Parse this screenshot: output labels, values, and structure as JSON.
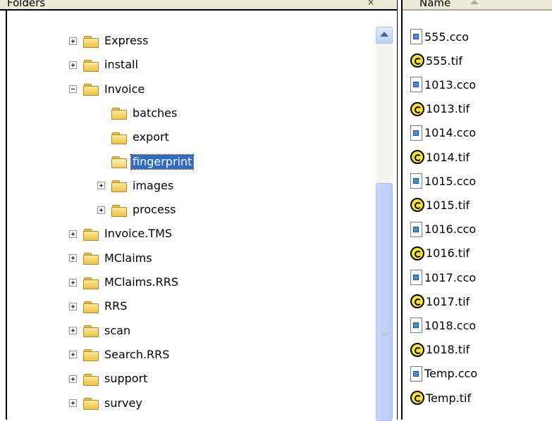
{
  "folders_pane": {
    "title": "Folders",
    "close_glyph": "×",
    "tree": [
      {
        "label": "Express",
        "expander": "plus",
        "level": 0,
        "selected": false
      },
      {
        "label": "install",
        "expander": "plus",
        "level": 0,
        "selected": false
      },
      {
        "label": "Invoice",
        "expander": "minus",
        "level": 0,
        "selected": false
      },
      {
        "label": "batches",
        "expander": "none",
        "level": 1,
        "selected": false
      },
      {
        "label": "export",
        "expander": "none",
        "level": 1,
        "selected": false
      },
      {
        "label": "fingerprint",
        "expander": "none",
        "level": 1,
        "selected": true
      },
      {
        "label": "images",
        "expander": "plus",
        "level": 1,
        "selected": false
      },
      {
        "label": "process",
        "expander": "plus",
        "level": 1,
        "selected": false
      },
      {
        "label": "Invoice.TMS",
        "expander": "plus",
        "level": 0,
        "selected": false
      },
      {
        "label": "MClaims",
        "expander": "plus",
        "level": 0,
        "selected": false
      },
      {
        "label": "MClaims.RRS",
        "expander": "plus",
        "level": 0,
        "selected": false
      },
      {
        "label": "RRS",
        "expander": "plus",
        "level": 0,
        "selected": false
      },
      {
        "label": "scan",
        "expander": "plus",
        "level": 0,
        "selected": false
      },
      {
        "label": "Search.RRS",
        "expander": "plus",
        "level": 0,
        "selected": false
      },
      {
        "label": "support",
        "expander": "plus",
        "level": 0,
        "selected": false
      },
      {
        "label": "survey",
        "expander": "plus",
        "level": 0,
        "selected": false
      }
    ]
  },
  "files_pane": {
    "column_name": "Name",
    "files": [
      {
        "name": "555.cco",
        "type": "cco"
      },
      {
        "name": "555.tif",
        "type": "tif"
      },
      {
        "name": "1013.cco",
        "type": "cco"
      },
      {
        "name": "1013.tif",
        "type": "tif"
      },
      {
        "name": "1014.cco",
        "type": "cco"
      },
      {
        "name": "1014.tif",
        "type": "tif"
      },
      {
        "name": "1015.cco",
        "type": "cco"
      },
      {
        "name": "1015.tif",
        "type": "tif"
      },
      {
        "name": "1016.cco",
        "type": "cco"
      },
      {
        "name": "1016.tif",
        "type": "tif"
      },
      {
        "name": "1017.cco",
        "type": "cco"
      },
      {
        "name": "1017.tif",
        "type": "tif"
      },
      {
        "name": "1018.cco",
        "type": "cco"
      },
      {
        "name": "1018.tif",
        "type": "tif"
      },
      {
        "name": "Temp.cco",
        "type": "cco"
      },
      {
        "name": "Temp.tif",
        "type": "tif"
      }
    ]
  },
  "colors": {
    "selection": "#316ac5",
    "folder": "#eec14b",
    "pane_header": "#ece9d8"
  }
}
